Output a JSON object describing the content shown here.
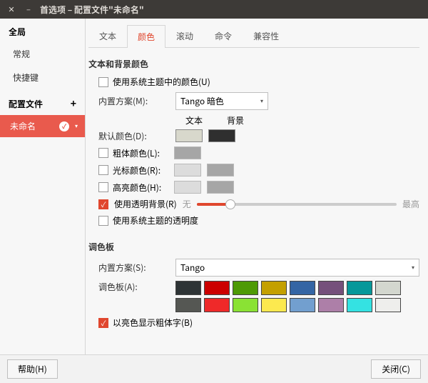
{
  "titlebar": {
    "title": "首选项 – 配置文件\"未命名\""
  },
  "sidebar": {
    "global_header": "全局",
    "items": [
      "常规",
      "快捷键"
    ],
    "profiles_header": "配置文件",
    "profile_name": "未命名"
  },
  "tabs": [
    "文本",
    "颜色",
    "滚动",
    "命令",
    "兼容性"
  ],
  "active_tab": 1,
  "text_bg": {
    "title": "文本和背景颜色",
    "use_theme_colors": "使用系统主题中的颜色(U)",
    "scheme_label": "内置方案(M):",
    "scheme_value": "Tango 暗色",
    "col_text": "文本",
    "col_bg": "背景",
    "default_color": "默认颜色(D):",
    "bold_color": "粗体颜色(L):",
    "cursor_color": "光标颜色(R):",
    "highlight_color": "高亮颜色(H):",
    "use_transparent": "使用透明背景(R)",
    "use_theme_transparency": "使用系统主题的透明度",
    "slider_min": "无",
    "slider_max": "最高",
    "slider_percent": 17,
    "default_text": "#d8d8cc",
    "default_bg": "#2f2f2f",
    "bold_text": "#646464",
    "cursor_text": "#c7c7c7",
    "cursor_bg": "#646464",
    "highlight_text": "#c7c7c7",
    "highlight_bg": "#646464"
  },
  "palette": {
    "title": "调色板",
    "scheme_label": "内置方案(S):",
    "scheme_value": "Tango",
    "palette_label": "调色板(A):",
    "colors_row1": [
      "#2e3436",
      "#cc0000",
      "#4e9a06",
      "#c4a000",
      "#3465a4",
      "#75507b",
      "#06989a",
      "#d3d7cf"
    ],
    "colors_row2": [
      "#555753",
      "#ef2929",
      "#8ae234",
      "#fce94f",
      "#729fcf",
      "#ad7fa8",
      "#34e2e2",
      "#eeeeec"
    ],
    "bold_bright": "以亮色显示粗体字(B)"
  },
  "footer": {
    "help": "帮助(H)",
    "close": "关闭(C)"
  }
}
